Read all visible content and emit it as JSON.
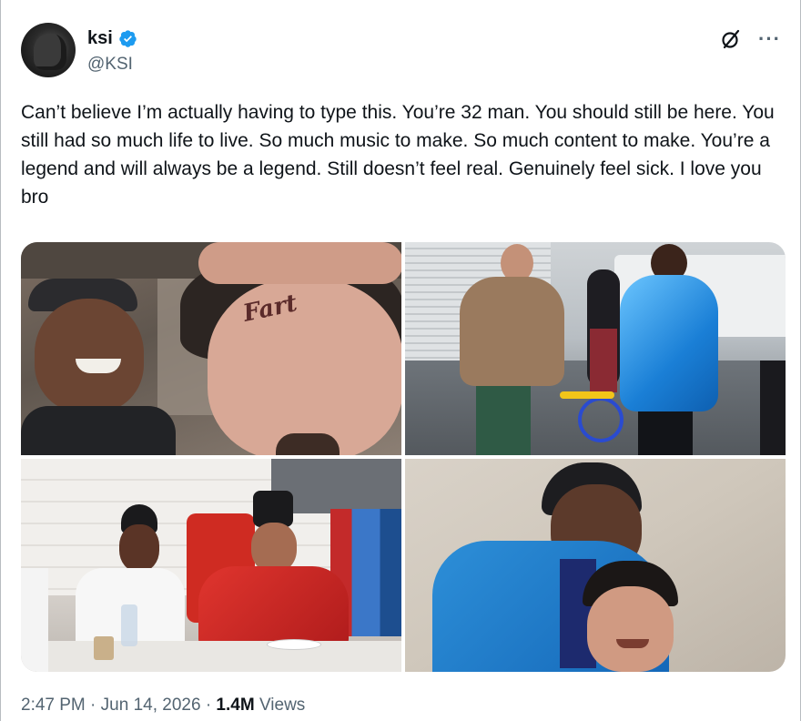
{
  "author": {
    "display_name": "ksi",
    "handle": "@KSI",
    "verified": true
  },
  "tweet": {
    "text": "Can’t believe I’m actually having to type this. You’re 32 man. You should still be here. You still had so much life to live. So much music to make. So much content to make. You’re a legend and will always be a legend. Still doesn’t feel real. Genuinely feel sick. I love you bro"
  },
  "media": {
    "photo_1": {
      "forehead_tattoo": "Fart"
    }
  },
  "meta": {
    "time": "2:47 PM",
    "separator": "·",
    "date": "Jun 14, 2026",
    "views_count": "1.4M",
    "views_label": "Views"
  },
  "icons": {
    "verified": "verified-badge-icon",
    "grok": "grok-icon",
    "more": "more-icon"
  },
  "colors": {
    "verified_blue": "#1d9bf0",
    "text_primary": "#0f1419",
    "text_secondary": "#536471"
  }
}
